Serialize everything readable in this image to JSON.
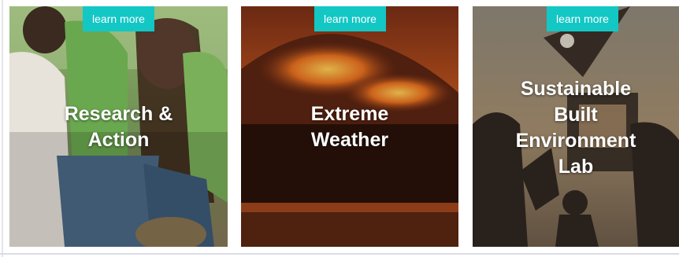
{
  "cards": [
    {
      "button_label": "learn more",
      "title_lines": [
        "Research &",
        "Action"
      ]
    },
    {
      "button_label": "learn more",
      "title_lines": [
        "Extreme",
        "Weather"
      ]
    },
    {
      "button_label": "learn more",
      "title_lines": [
        "Sustainable",
        "Built",
        "Environment",
        "Lab"
      ]
    }
  ],
  "colors": {
    "button_bg": "#13c7c5",
    "title_text": "#ffffff"
  }
}
